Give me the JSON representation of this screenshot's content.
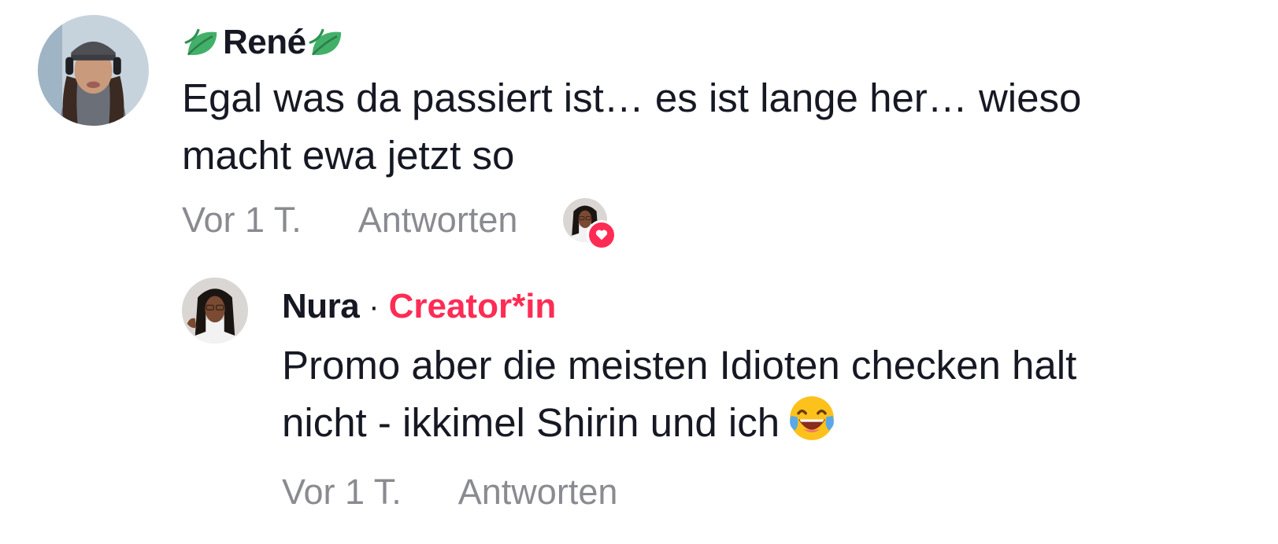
{
  "comment": {
    "username": "René",
    "text_line1": "Egal was da passiert ist… es ist lange her… wieso",
    "text_line2": "macht ewa jetzt so",
    "time": "Vor 1 T.",
    "reply_label": "Antworten",
    "avatar_icon": "user-avatar-icon",
    "decoration_icon": "leaf-icon",
    "liked_by_creator_icon": "creator-liked-heart-icon"
  },
  "reply": {
    "username": "Nura",
    "separator": "·",
    "badge": "Creator*in",
    "text_line1": "Promo aber die meisten Idioten checken halt",
    "text_line2": "nicht - ikkimel Shirin und ich",
    "emoji_icon": "face-with-tears-of-joy-icon",
    "time": "Vor 1 T.",
    "reply_label": "Antworten"
  },
  "colors": {
    "creator_accent": "#fe2c55",
    "meta_gray": "#8a8b91",
    "text": "#161823"
  }
}
